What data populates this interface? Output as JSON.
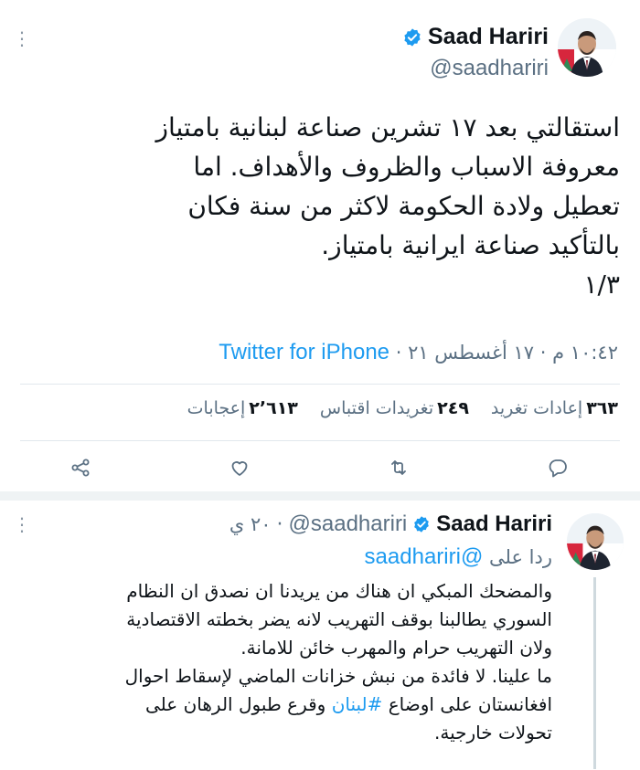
{
  "main_tweet": {
    "author": {
      "display_name": "Saad Hariri",
      "handle": "@saadhariri",
      "verified_icon": "verified-badge-icon"
    },
    "text_lines": [
      "استقالتي بعد ١٧ تشرين صناعة لبنانية بامتياز",
      "معروفة الاسباب والظروف والأهداف. اما",
      "تعطيل ولادة الحكومة لاكثر من سنة فكان",
      "بالتأكيد صناعة ايرانية بامتياز.",
      "١/٣"
    ],
    "meta": {
      "time_date": "١٠:٤٢ م · ١٧ أغسطس ٢١ · ",
      "source": "Twitter for iPhone"
    },
    "stats": {
      "retweets_count": "٣٦٣",
      "retweets_label": "إعادات تغريد",
      "quotes_count": "٢٤٩",
      "quotes_label": "تغريدات اقتباس",
      "likes_count": "٢٬٦١٣",
      "likes_label": "إعجابات"
    },
    "actions": [
      "reply-icon",
      "retweet-icon",
      "like-icon",
      "share-icon"
    ]
  },
  "reply_tweet": {
    "author": {
      "display_name": "Saad Hariri",
      "handle": "@saadhariri",
      "time": "٢٠ ي"
    },
    "replying_to_label": "ردا على",
    "replying_to_handle": "@saadhariri",
    "text_lines_1": [
      "والمضحك المبكي ان هناك من يريدنا ان نصدق ان النظام",
      "السوري يطالبنا بوقف التهريب لانه يضر بخطته الاقتصادية",
      "ولان التهريب حرام والمهرب خائن للامانة."
    ],
    "text_line_4": "ما علينا. لا فائدة من نبش خزانات الماضي لإسقاط احوال",
    "text_line_5_before": "افغانستان على اوضاع ",
    "hashtag": "#لبنان",
    "text_line_5_after": " وقرع طبول الرهان على",
    "text_line_6": "تحولات خارجية."
  },
  "colors": {
    "accent": "#1d9bf0",
    "text": "#0f1419",
    "secondary": "#5b7083",
    "divider": "#e1e8ed"
  }
}
